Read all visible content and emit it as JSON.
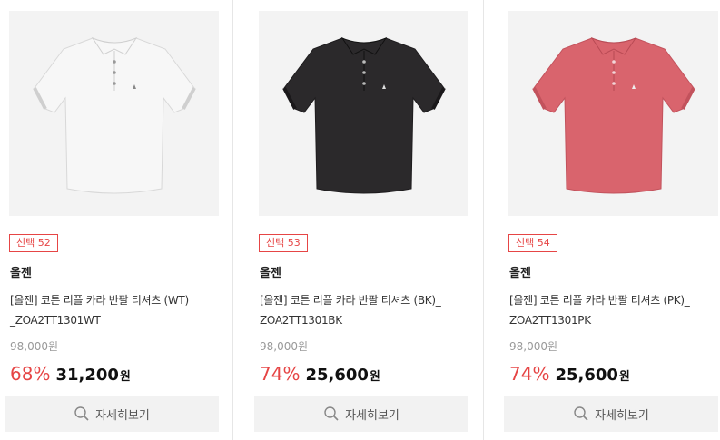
{
  "products": [
    {
      "badge": "선택 52",
      "brand": "올젠",
      "name_line1": "[올젠] 코튼 리플 카라 반팔 티셔츠 (WT)",
      "name_line2": "_ZOA2TT1301WT",
      "original_price": "98,000원",
      "discount": "68%",
      "price": "31,200",
      "currency": "원",
      "detail_label": "자세히보기",
      "shirt_color": "#f7f7f7",
      "image_icon": "white-polo-shirt"
    },
    {
      "badge": "선택 53",
      "brand": "올젠",
      "name_line1": "[올젠] 코튼 리플 카라 반팔 티셔츠 (BK)_",
      "name_line2": "ZOA2TT1301BK",
      "original_price": "98,000원",
      "discount": "74%",
      "price": "25,600",
      "currency": "원",
      "detail_label": "자세히보기",
      "shirt_color": "#2b292b",
      "image_icon": "black-polo-shirt"
    },
    {
      "badge": "선택 54",
      "brand": "올젠",
      "name_line1": "[올젠] 코튼 리플 카라 반팔 티셔츠 (PK)_",
      "name_line2": "ZOA2TT1301PK",
      "original_price": "98,000원",
      "discount": "74%",
      "price": "25,600",
      "currency": "원",
      "detail_label": "자세히보기",
      "shirt_color": "#d9646d",
      "image_icon": "pink-polo-shirt"
    }
  ],
  "colors": {
    "accent": "#e64545",
    "button_bg": "#f2f2f2",
    "image_bg": "#f3f3f3"
  }
}
